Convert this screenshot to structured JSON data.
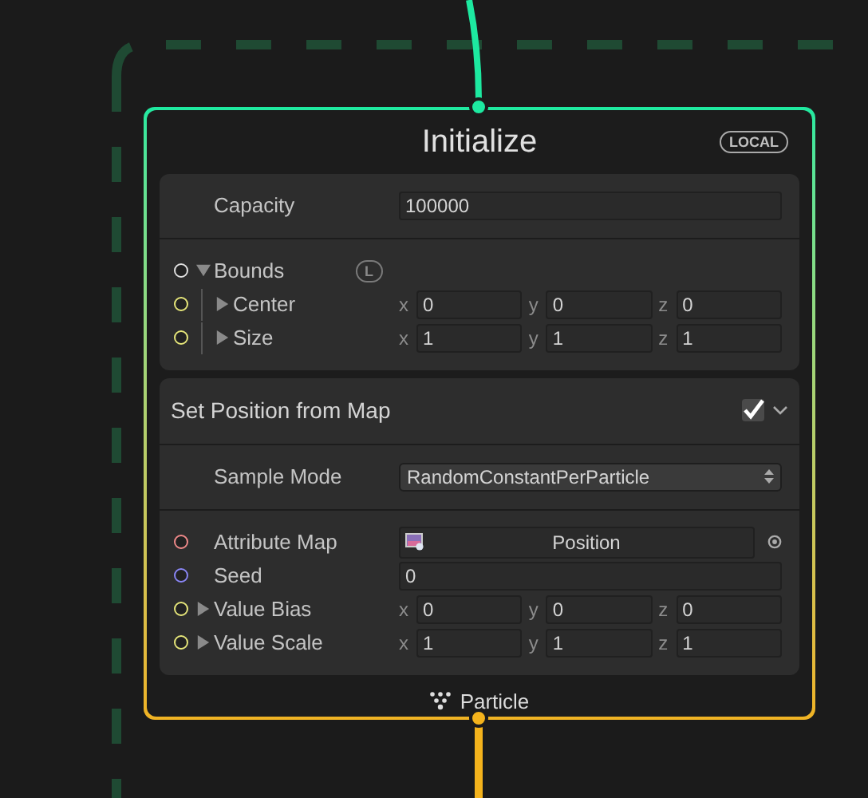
{
  "node": {
    "title": "Initialize",
    "space_badge": "LOCAL",
    "footer": "Particle",
    "blocks": [
      {
        "kind": "settings",
        "sections": [
          [
            {
              "kind": "text",
              "label": "Capacity",
              "value": "100000"
            }
          ],
          [
            {
              "kind": "group",
              "label": "Bounds",
              "badge": "L",
              "expanded": true,
              "color": "#e0e0e0",
              "children": [
                {
                  "kind": "vector",
                  "label": "Center",
                  "expanded": false,
                  "color": "#e6e67a",
                  "components": [
                    {
                      "axis": "x",
                      "value": "0"
                    },
                    {
                      "axis": "y",
                      "value": "0"
                    },
                    {
                      "axis": "z",
                      "value": "0"
                    }
                  ]
                },
                {
                  "kind": "vector",
                  "label": "Size",
                  "expanded": false,
                  "color": "#e6e67a",
                  "components": [
                    {
                      "axis": "x",
                      "value": "1"
                    },
                    {
                      "axis": "y",
                      "value": "1"
                    },
                    {
                      "axis": "z",
                      "value": "1"
                    }
                  ]
                }
              ]
            }
          ]
        ]
      },
      {
        "kind": "block",
        "title": "Set Position from Map",
        "enabled": true,
        "expanded": true,
        "sections": [
          [
            {
              "kind": "select",
              "label": "Sample Mode",
              "value": "RandomConstantPerParticle"
            }
          ],
          [
            {
              "kind": "object",
              "label": "Attribute Map",
              "value": "Position",
              "color": "#f08a8a"
            },
            {
              "kind": "text",
              "label": "Seed",
              "value": "0",
              "color": "#8a86f5"
            },
            {
              "kind": "vector",
              "label": "Value Bias",
              "expanded": false,
              "color": "#e6e67a",
              "components": [
                {
                  "axis": "x",
                  "value": "0"
                },
                {
                  "axis": "y",
                  "value": "0"
                },
                {
                  "axis": "z",
                  "value": "0"
                }
              ]
            },
            {
              "kind": "vector",
              "label": "Value Scale",
              "expanded": false,
              "color": "#e6e67a",
              "components": [
                {
                  "axis": "x",
                  "value": "1"
                },
                {
                  "axis": "y",
                  "value": "1"
                },
                {
                  "axis": "z",
                  "value": "1"
                }
              ]
            }
          ]
        ]
      }
    ]
  }
}
